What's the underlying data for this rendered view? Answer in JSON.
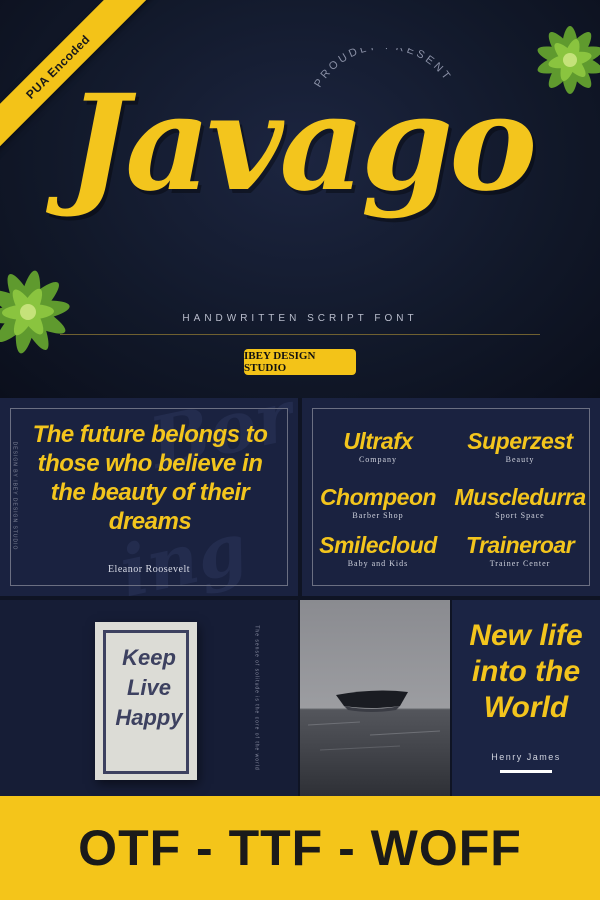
{
  "hero": {
    "ribbon_label": "PUA Encoded",
    "proudly_text": "PROUDLY PRESENT",
    "title": "Javago",
    "subtitle": "HANDWRITTEN SCRIPT FONT",
    "studio_label": "IBEY DESIGN STUDIO"
  },
  "quote_panel": {
    "quote": "The future belongs to those who believe in the beauty of their dreams",
    "author": "Eleanor Roosevelt",
    "side_text": "DESIGN BY IBEY DESIGN STUDIO"
  },
  "logos_panel": {
    "logos": [
      {
        "name": "Ultrafx",
        "tagline": "Company"
      },
      {
        "name": "Superzest",
        "tagline": "Beauty"
      },
      {
        "name": "Chompeon",
        "tagline": "Barber Shop"
      },
      {
        "name": "Muscledurra",
        "tagline": "Sport Space"
      },
      {
        "name": "Smilecloud",
        "tagline": "Baby and Kids"
      },
      {
        "name": "Traineroar",
        "tagline": "Trainer Center"
      }
    ]
  },
  "poster_panel": {
    "lines": [
      "Keep",
      "Live",
      "Happy"
    ],
    "side_text": "The sense of solitude is the core of the world"
  },
  "newlife_panel": {
    "lines": [
      "New life",
      "into the",
      "World"
    ],
    "author": "Henry James"
  },
  "footer": {
    "formats": "OTF - TTF - WOFF"
  },
  "colors": {
    "accent": "#f3c51d",
    "navy": "#1a2240",
    "dark": "#111829"
  }
}
